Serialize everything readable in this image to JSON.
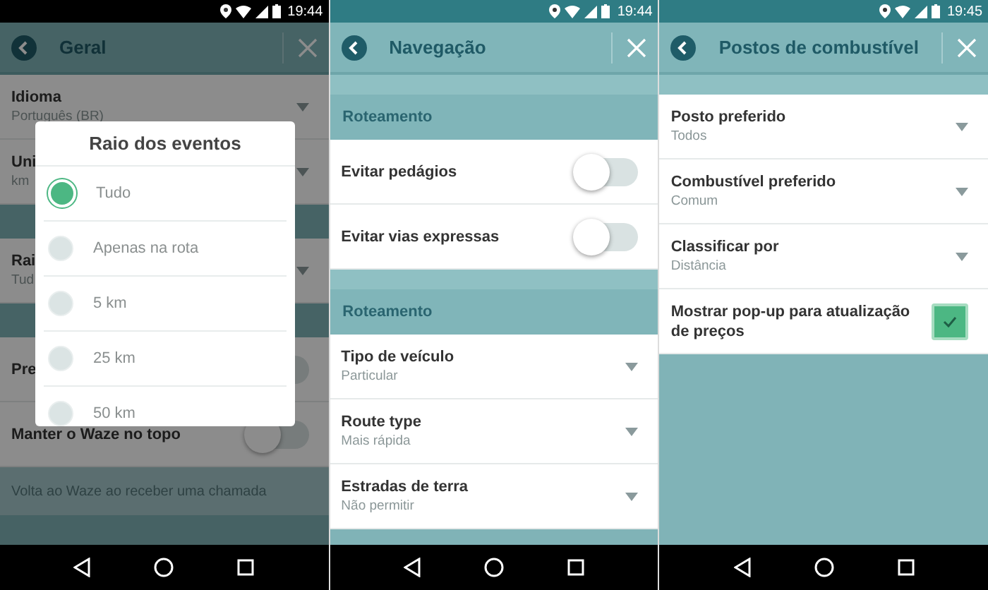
{
  "screens": [
    {
      "status_bar": {
        "time": "19:44",
        "dark": true
      },
      "header": {
        "title": "Geral"
      },
      "dimmed": true,
      "items": [
        {
          "kind": "select",
          "label": "Idioma",
          "value": "Português (BR)"
        },
        {
          "kind": "select",
          "label": "Uni",
          "value": "km"
        },
        {
          "kind": "band"
        },
        {
          "kind": "select",
          "label": "Rai",
          "value": "Tud"
        },
        {
          "kind": "band"
        },
        {
          "kind": "toggle",
          "label": "Pre",
          "on": false
        },
        {
          "kind": "toggle",
          "label": "Manter o Waze no topo",
          "on": false
        },
        {
          "kind": "note",
          "text": "Volta ao Waze ao receber uma chamada"
        }
      ],
      "dialog": {
        "title": "Raio dos eventos",
        "options": [
          {
            "label": "Tudo",
            "selected": true
          },
          {
            "label": "Apenas na rota",
            "selected": false
          },
          {
            "label": "5 km",
            "selected": false
          },
          {
            "label": "25 km",
            "selected": false
          },
          {
            "label": "50 km",
            "selected": false
          }
        ]
      }
    },
    {
      "status_bar": {
        "time": "19:44",
        "dark": false
      },
      "header": {
        "title": "Navegação"
      },
      "dimmed": false,
      "items": [
        {
          "kind": "strip"
        },
        {
          "kind": "section",
          "label": "Roteamento"
        },
        {
          "kind": "toggle",
          "label": "Evitar pedágios",
          "on": false
        },
        {
          "kind": "toggle",
          "label": "Evitar vias expressas",
          "on": false
        },
        {
          "kind": "strip"
        },
        {
          "kind": "section",
          "label": "Roteamento"
        },
        {
          "kind": "select",
          "label": "Tipo de veículo",
          "value": "Particular"
        },
        {
          "kind": "select",
          "label": "Route type",
          "value": "Mais rápida"
        },
        {
          "kind": "select",
          "label": "Estradas de terra",
          "value": "Não permitir"
        }
      ]
    },
    {
      "status_bar": {
        "time": "19:45",
        "dark": false
      },
      "header": {
        "title": "Postos de combustível"
      },
      "dimmed": false,
      "items": [
        {
          "kind": "strip"
        },
        {
          "kind": "select",
          "label": "Posto preferido",
          "value": "Todos"
        },
        {
          "kind": "select",
          "label": "Combustível preferido",
          "value": "Comum"
        },
        {
          "kind": "select",
          "label": "Classificar por",
          "value": "Distância"
        },
        {
          "kind": "checkbox",
          "label": "Mostrar pop-up para atualização de preços",
          "checked": true
        }
      ]
    }
  ]
}
